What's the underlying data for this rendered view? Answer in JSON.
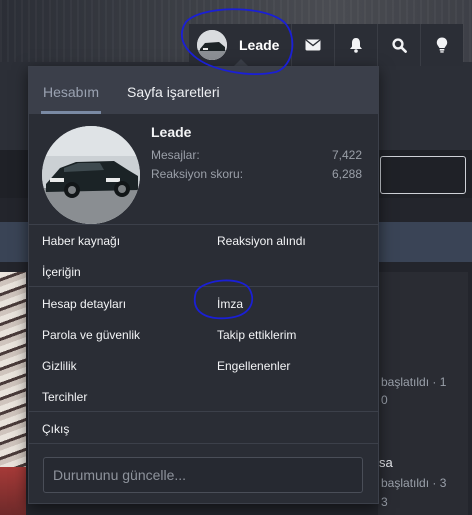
{
  "header": {
    "username": "Leade",
    "icons": [
      "envelope-icon",
      "bell-icon",
      "search-icon",
      "lightbulb-icon"
    ]
  },
  "menu": {
    "tabs": [
      {
        "label": "Hesabım",
        "active": true
      },
      {
        "label": "Sayfa işaretleri",
        "active": false
      }
    ],
    "profile": {
      "name": "Leade",
      "stats": [
        {
          "label": "Mesajlar:",
          "value": "7,422"
        },
        {
          "label": "Reaksiyon skoru:",
          "value": "6,288"
        }
      ]
    },
    "links_left": [
      "Haber kaynağı",
      "İçeriğin"
    ],
    "links_right": [
      "Reaksiyon alındı"
    ],
    "links2_left": [
      "Hesap detayları",
      "Parola ve güvenlik",
      "Gizlilik",
      "Tercihler"
    ],
    "links2_right": [
      "İmza",
      "Takip ettiklerim",
      "Engellenenler"
    ],
    "logout": "Çıkış",
    "status_placeholder": "Durumunu güncelle..."
  },
  "background": {
    "snippets": [
      "başlatıldı · 1",
      "0",
      "sa",
      "başlatıldı · 3",
      "3"
    ]
  },
  "colors": {
    "menu_bg": "#2a2d35",
    "tab_bar": "#3b3f4a",
    "annotation": "#1a1fd6"
  }
}
